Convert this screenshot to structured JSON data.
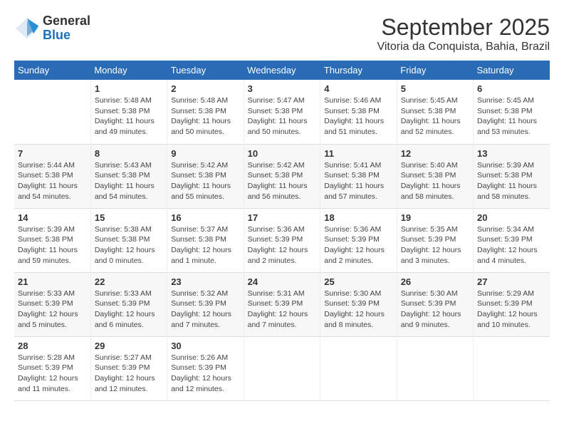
{
  "logo": {
    "general": "General",
    "blue": "Blue"
  },
  "header": {
    "month": "September 2025",
    "location": "Vitoria da Conquista, Bahia, Brazil"
  },
  "days_of_week": [
    "Sunday",
    "Monday",
    "Tuesday",
    "Wednesday",
    "Thursday",
    "Friday",
    "Saturday"
  ],
  "weeks": [
    [
      {
        "num": "",
        "info": ""
      },
      {
        "num": "1",
        "info": "Sunrise: 5:48 AM\nSunset: 5:38 PM\nDaylight: 11 hours\nand 49 minutes."
      },
      {
        "num": "2",
        "info": "Sunrise: 5:48 AM\nSunset: 5:38 PM\nDaylight: 11 hours\nand 50 minutes."
      },
      {
        "num": "3",
        "info": "Sunrise: 5:47 AM\nSunset: 5:38 PM\nDaylight: 11 hours\nand 50 minutes."
      },
      {
        "num": "4",
        "info": "Sunrise: 5:46 AM\nSunset: 5:38 PM\nDaylight: 11 hours\nand 51 minutes."
      },
      {
        "num": "5",
        "info": "Sunrise: 5:45 AM\nSunset: 5:38 PM\nDaylight: 11 hours\nand 52 minutes."
      },
      {
        "num": "6",
        "info": "Sunrise: 5:45 AM\nSunset: 5:38 PM\nDaylight: 11 hours\nand 53 minutes."
      }
    ],
    [
      {
        "num": "7",
        "info": "Sunrise: 5:44 AM\nSunset: 5:38 PM\nDaylight: 11 hours\nand 54 minutes."
      },
      {
        "num": "8",
        "info": "Sunrise: 5:43 AM\nSunset: 5:38 PM\nDaylight: 11 hours\nand 54 minutes."
      },
      {
        "num": "9",
        "info": "Sunrise: 5:42 AM\nSunset: 5:38 PM\nDaylight: 11 hours\nand 55 minutes."
      },
      {
        "num": "10",
        "info": "Sunrise: 5:42 AM\nSunset: 5:38 PM\nDaylight: 11 hours\nand 56 minutes."
      },
      {
        "num": "11",
        "info": "Sunrise: 5:41 AM\nSunset: 5:38 PM\nDaylight: 11 hours\nand 57 minutes."
      },
      {
        "num": "12",
        "info": "Sunrise: 5:40 AM\nSunset: 5:38 PM\nDaylight: 11 hours\nand 58 minutes."
      },
      {
        "num": "13",
        "info": "Sunrise: 5:39 AM\nSunset: 5:38 PM\nDaylight: 11 hours\nand 58 minutes."
      }
    ],
    [
      {
        "num": "14",
        "info": "Sunrise: 5:39 AM\nSunset: 5:38 PM\nDaylight: 11 hours\nand 59 minutes."
      },
      {
        "num": "15",
        "info": "Sunrise: 5:38 AM\nSunset: 5:38 PM\nDaylight: 12 hours\nand 0 minutes."
      },
      {
        "num": "16",
        "info": "Sunrise: 5:37 AM\nSunset: 5:38 PM\nDaylight: 12 hours\nand 1 minute."
      },
      {
        "num": "17",
        "info": "Sunrise: 5:36 AM\nSunset: 5:39 PM\nDaylight: 12 hours\nand 2 minutes."
      },
      {
        "num": "18",
        "info": "Sunrise: 5:36 AM\nSunset: 5:39 PM\nDaylight: 12 hours\nand 2 minutes."
      },
      {
        "num": "19",
        "info": "Sunrise: 5:35 AM\nSunset: 5:39 PM\nDaylight: 12 hours\nand 3 minutes."
      },
      {
        "num": "20",
        "info": "Sunrise: 5:34 AM\nSunset: 5:39 PM\nDaylight: 12 hours\nand 4 minutes."
      }
    ],
    [
      {
        "num": "21",
        "info": "Sunrise: 5:33 AM\nSunset: 5:39 PM\nDaylight: 12 hours\nand 5 minutes."
      },
      {
        "num": "22",
        "info": "Sunrise: 5:33 AM\nSunset: 5:39 PM\nDaylight: 12 hours\nand 6 minutes."
      },
      {
        "num": "23",
        "info": "Sunrise: 5:32 AM\nSunset: 5:39 PM\nDaylight: 12 hours\nand 7 minutes."
      },
      {
        "num": "24",
        "info": "Sunrise: 5:31 AM\nSunset: 5:39 PM\nDaylight: 12 hours\nand 7 minutes."
      },
      {
        "num": "25",
        "info": "Sunrise: 5:30 AM\nSunset: 5:39 PM\nDaylight: 12 hours\nand 8 minutes."
      },
      {
        "num": "26",
        "info": "Sunrise: 5:30 AM\nSunset: 5:39 PM\nDaylight: 12 hours\nand 9 minutes."
      },
      {
        "num": "27",
        "info": "Sunrise: 5:29 AM\nSunset: 5:39 PM\nDaylight: 12 hours\nand 10 minutes."
      }
    ],
    [
      {
        "num": "28",
        "info": "Sunrise: 5:28 AM\nSunset: 5:39 PM\nDaylight: 12 hours\nand 11 minutes."
      },
      {
        "num": "29",
        "info": "Sunrise: 5:27 AM\nSunset: 5:39 PM\nDaylight: 12 hours\nand 12 minutes."
      },
      {
        "num": "30",
        "info": "Sunrise: 5:26 AM\nSunset: 5:39 PM\nDaylight: 12 hours\nand 12 minutes."
      },
      {
        "num": "",
        "info": ""
      },
      {
        "num": "",
        "info": ""
      },
      {
        "num": "",
        "info": ""
      },
      {
        "num": "",
        "info": ""
      }
    ]
  ]
}
